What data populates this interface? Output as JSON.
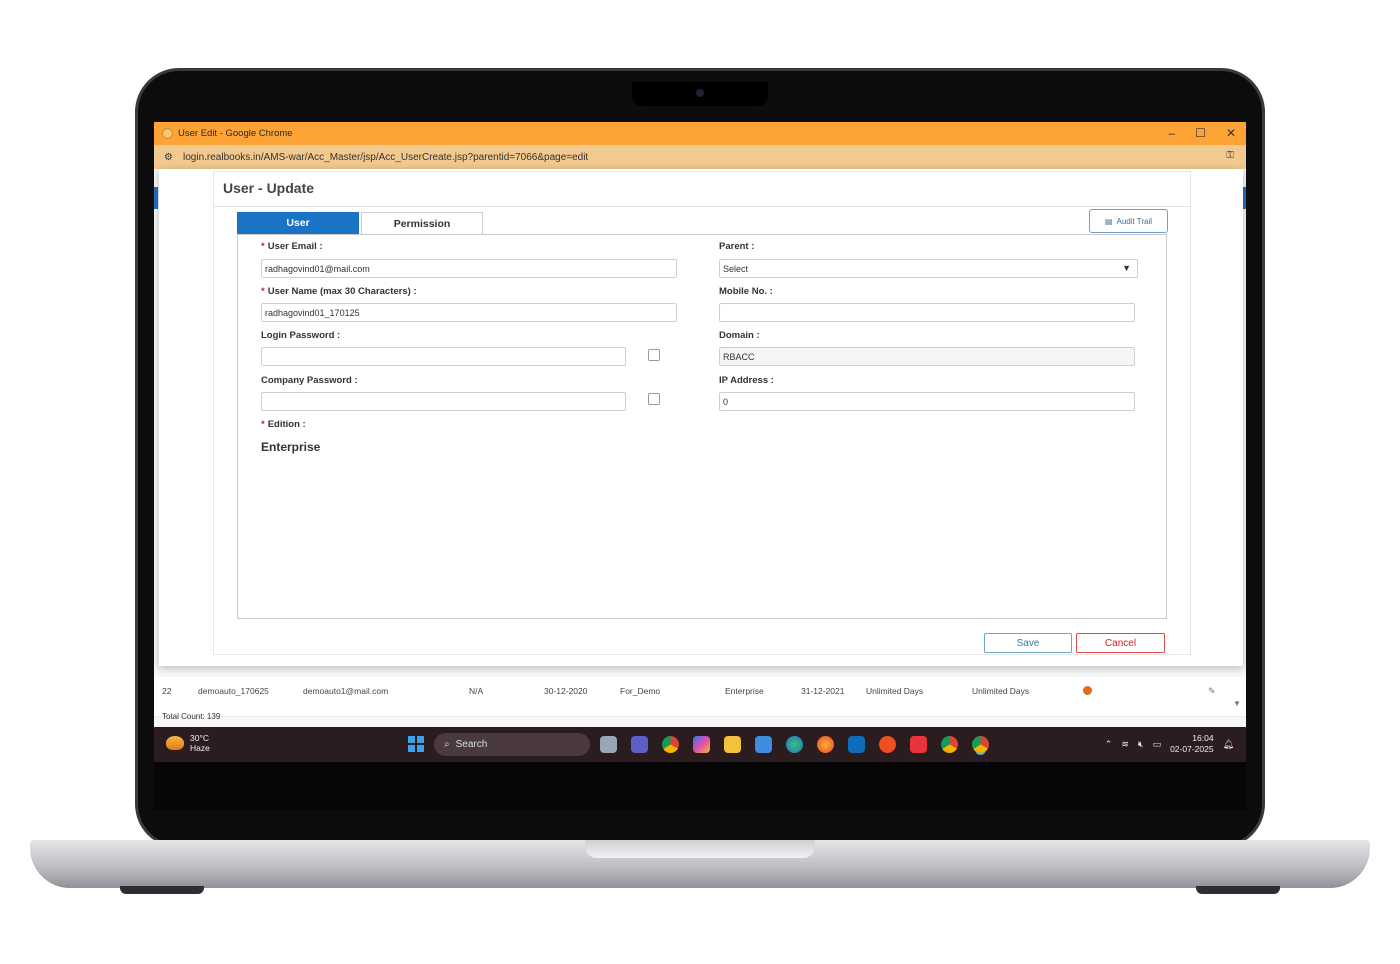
{
  "window": {
    "title": "User Edit - Google Chrome",
    "url": "login.realbooks.in/AMS-war/Acc_Master/jsp/Acc_UserCreate.jsp?parentid=7066&page=edit",
    "minimize": "–",
    "maximize": "☐",
    "close": "✕"
  },
  "modal": {
    "title": "User - Update",
    "tabs": [
      {
        "label": "User"
      },
      {
        "label": "Permission"
      }
    ],
    "audit_label": "Audit Trail",
    "fields": {
      "user_email_label": "User Email :",
      "user_email_value": "radhagovind01@mail.com",
      "user_name_label": "User Name (max 30 Characters) :",
      "user_name_value": "radhagovind01_170125",
      "login_password_label": "Login Password :",
      "company_password_label": "Company Password :",
      "edition_label": "Edition :",
      "edition_value": "Enterprise",
      "parent_label": "Parent :",
      "parent_value": "Select",
      "mobile_label": "Mobile No. :",
      "mobile_value": "",
      "domain_label": "Domain :",
      "domain_value": "RBACC",
      "ip_label": "IP Address :",
      "ip_value": "0"
    },
    "required_mark": "*",
    "save_label": "Save",
    "cancel_label": "Cancel"
  },
  "background_table": {
    "row": {
      "index": "22",
      "user": "demoauto_170625",
      "email": "demoauto1@mail.com",
      "parent": "N/A",
      "start": "30-12-2020",
      "domain": "For_Demo",
      "edition": "Enterprise",
      "end": "31-12-2021",
      "days1": "Unlimited Days",
      "days2": "Unlimited Days"
    },
    "total_count": "Total Count: 139",
    "status_color": "#e46a1b"
  },
  "taskbar": {
    "temperature": "30°C",
    "weather": "Haze",
    "search": "Search",
    "time": "16:04",
    "date": "02-07-2025"
  },
  "colors": {
    "titlebar": "#fea437",
    "accent": "#1a73c4",
    "cancel": "#c62828",
    "required": "#d62020"
  }
}
